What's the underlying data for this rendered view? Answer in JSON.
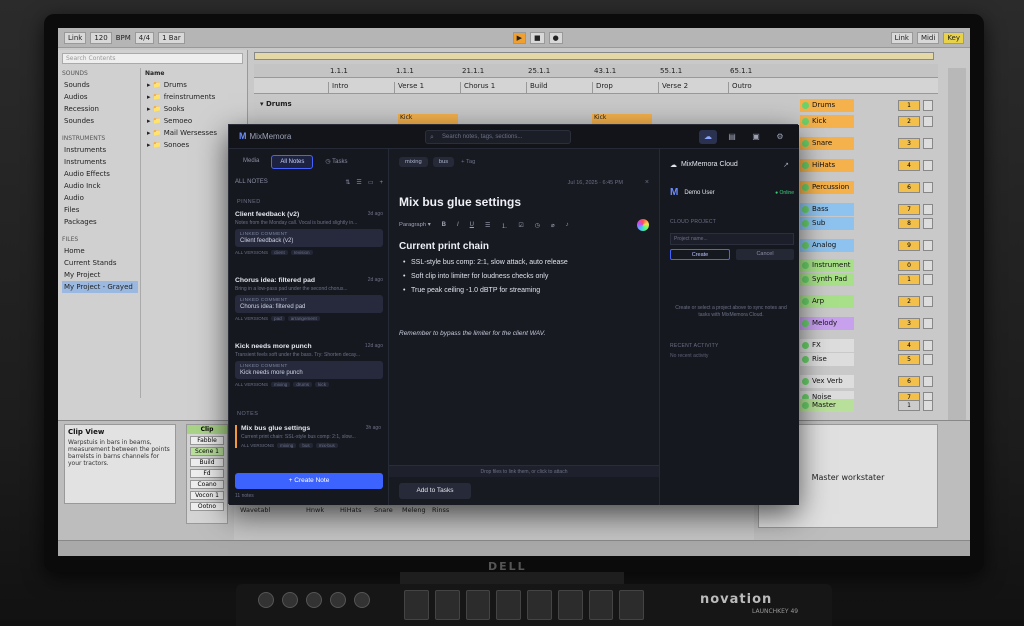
{
  "daw": {
    "top_cells": [
      "Link",
      "120",
      "BPM",
      "4/4",
      "1 Bar"
    ],
    "top_right": [
      "Link",
      "Midi",
      "Key"
    ],
    "browser": {
      "search_placeholder": "Search Contents",
      "sections": [
        {
          "head": "SOUNDS",
          "items": [
            "Sounds",
            "Audios",
            "Recession",
            "Soundes"
          ]
        },
        {
          "head": "INSTRUMENTS",
          "items": [
            "Instruments",
            "Instruments",
            "Audio Effects",
            "Audio Inck",
            "Audio",
            "Files",
            "Packages"
          ]
        },
        {
          "head": "FILES",
          "items": [
            "Home",
            "Current Stands",
            "My Project",
            "My Project - Grayed"
          ]
        }
      ],
      "name_header": "Name",
      "name_items": [
        "Drums",
        "freinstruments",
        "Sooks",
        "Semoeo",
        "Mail Wersesses",
        "Sonoes"
      ]
    },
    "ruler": [
      "1.1.1",
      "1.1.1",
      "21.1.1",
      "25.1.1",
      "43.1.1",
      "55.1.1",
      "65.1.1"
    ],
    "locators": [
      "Intro",
      "Verse 1",
      "Chorus 1",
      "Build",
      "Drop",
      "Verse 2",
      "Outro"
    ],
    "track_header": "Drums",
    "clips": [
      "Kick",
      "Kick"
    ],
    "mixer": [
      "Drums",
      "Kick",
      "Snare",
      "HiHats",
      "Percussion",
      "Bass",
      "Sub",
      "Analog",
      "Instrument",
      "Synth Pad",
      "Arp",
      "Melody",
      "FX",
      "Rise",
      "Vex Verb",
      "Noise",
      "Master"
    ],
    "clip_view_title": "Clip View",
    "clip_view_text": "Warpstuis in bars in bearns, measurement between the points barrelsts in barns channels for your tractors.",
    "clip_panel": {
      "head": "Clip",
      "buttons": [
        "Fabble",
        "Scene 1",
        "Build",
        "Fd",
        "Coano",
        "Vocon 1",
        "Ootno"
      ]
    },
    "devices": [
      "Wavetabl",
      "Hnwk",
      "HiHats",
      "Snare",
      "Meleng",
      "Rinss"
    ],
    "master_workstation": "Master workstater"
  },
  "mm": {
    "app_name": "MixMemora",
    "search_placeholder": "Search notes, tags, sections...",
    "side_tabs": [
      "Media",
      "All Notes",
      "Tasks"
    ],
    "all_notes_label": "ALL NOTES",
    "pinned_label": "PINNED",
    "notes_label": "NOTES",
    "linked_label": "LINKED COMMENT",
    "notes": [
      {
        "title": "Client feedback (v2)",
        "ago": "3d ago",
        "preview": "Notes from the Monday call. Vocal is buried slightly in...",
        "linked": "Client feedback (v2)",
        "meta": [
          "ALL VERSIONS",
          "client",
          "revision"
        ]
      },
      {
        "title": "Chorus idea: filtered pad",
        "ago": "2d ago",
        "preview": "Bring in a low-pass pad under the second chorus...",
        "linked": "Chorus idea: filtered pad",
        "meta": [
          "ALL VERSIONS",
          "pad",
          "arrangement"
        ]
      },
      {
        "title": "Kick needs more punch",
        "ago": "12d ago",
        "preview": "Transient feels soft under the bass. Try: Shorten decay...",
        "linked": "Kick needs more punch",
        "meta": [
          "ALL VERSIONS",
          "mixing",
          "drums",
          "kick"
        ]
      },
      {
        "title": "Mix bus glue settings",
        "ago": "3h ago",
        "preview": "Current print chain: SSL-style bus comp: 2:1, slow...",
        "meta": [
          "ALL VERSIONS",
          "mixing",
          "bus",
          "mix-bus"
        ]
      }
    ],
    "create_button": "+ Create Note",
    "note_count": "11 notes",
    "editor": {
      "tags": [
        "mixing",
        "bus"
      ],
      "add_tag": "+ Tag",
      "date": "Jul 16, 2025 · 6:45 PM",
      "close": "×",
      "title": "Mix bus glue settings",
      "paragraph": "Paragraph",
      "heading": "Current print chain",
      "bullets": [
        "SSL-style bus comp: 2:1, slow attack, auto release",
        "Soft clip into limiter for loudness checks only",
        "True peak ceiling -1.0 dBTP for streaming"
      ],
      "italic": "Remember to bypass the limiter for the client WAV.",
      "drop_hint": "Drop files to link them, or click to attach",
      "add_tasks": "Add to Tasks"
    },
    "cloud": {
      "title": "MixMemora Cloud",
      "user": "Demo User",
      "status": "● Online",
      "project_label": "CLOUD PROJECT",
      "project_placeholder": "Project name...",
      "create": "Create",
      "cancel": "Cancel",
      "help": "Create or select a project above to sync notes and tasks with MixMemora Cloud.",
      "activity_label": "RECENT ACTIVITY",
      "no_activity": "No recent activity"
    }
  },
  "hardware": {
    "monitor_brand": "DELL",
    "keyboard_brand": "novation",
    "keyboard_model": "LAUNCHKEY 49"
  },
  "colors": {
    "accent": "#3d63ff",
    "clip_orange": "#f4b14c",
    "online": "#39d27a"
  }
}
